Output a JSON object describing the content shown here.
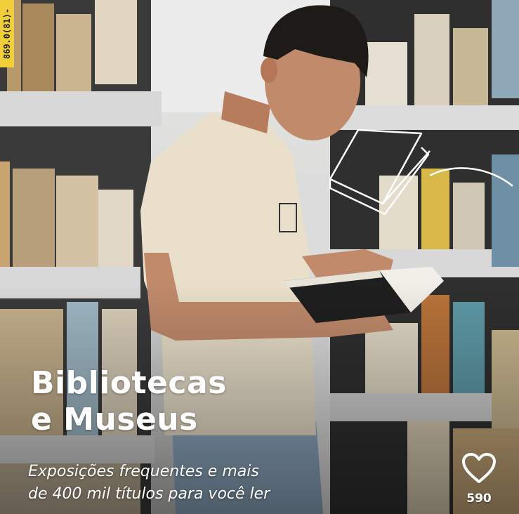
{
  "overlay": {
    "title_line1": "Bibliotecas",
    "title_line2": "e Museus",
    "subtitle_line1": "Exposições frequentes e mais",
    "subtitle_line2": "de 400 mil títulos para você ler"
  },
  "like": {
    "icon": "heart-icon",
    "count": "590"
  },
  "book_spine_label": "869.0(81)-",
  "colors": {
    "overlay_text": "#ffffff",
    "shirt": "#e9dfca",
    "jeans": "#8ea8c0",
    "shelf": "#d9d9d9"
  }
}
